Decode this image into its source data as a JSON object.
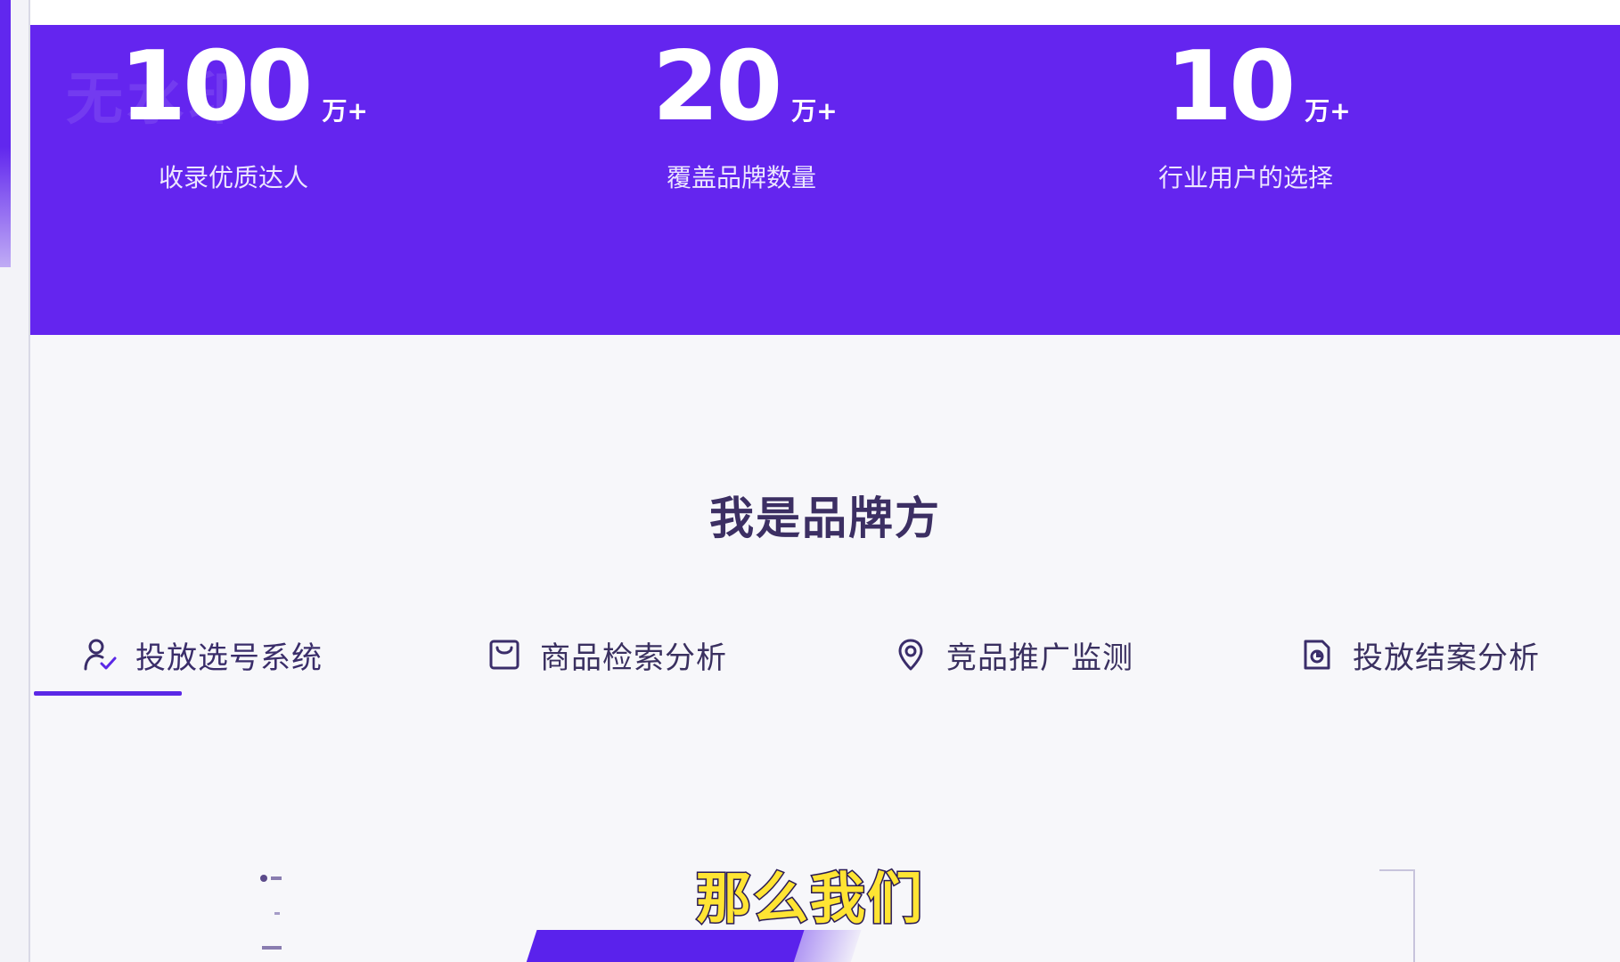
{
  "watermark": "无水印",
  "stats": [
    {
      "number": "100",
      "unit": "万+",
      "label": "收录优质达人"
    },
    {
      "number": "20",
      "unit": "万+",
      "label": "覆盖品牌数量"
    },
    {
      "number": "10",
      "unit": "万+",
      "label": "行业用户的选择"
    }
  ],
  "section": {
    "title": "我是品牌方"
  },
  "tabs": [
    {
      "label": "投放选号系统",
      "icon": "user-check-icon",
      "active": true
    },
    {
      "label": "商品检索分析",
      "icon": "shopping-bag-icon",
      "active": false
    },
    {
      "label": "竞品推广监测",
      "icon": "location-pin-icon",
      "active": false
    },
    {
      "label": "投放结案分析",
      "icon": "document-chart-icon",
      "active": false
    }
  ],
  "subtitle": "那么我们",
  "colors": {
    "brand_purple": "#6425ef",
    "title_text": "#3c2f63",
    "subtitle_yellow": "#ffe433"
  }
}
